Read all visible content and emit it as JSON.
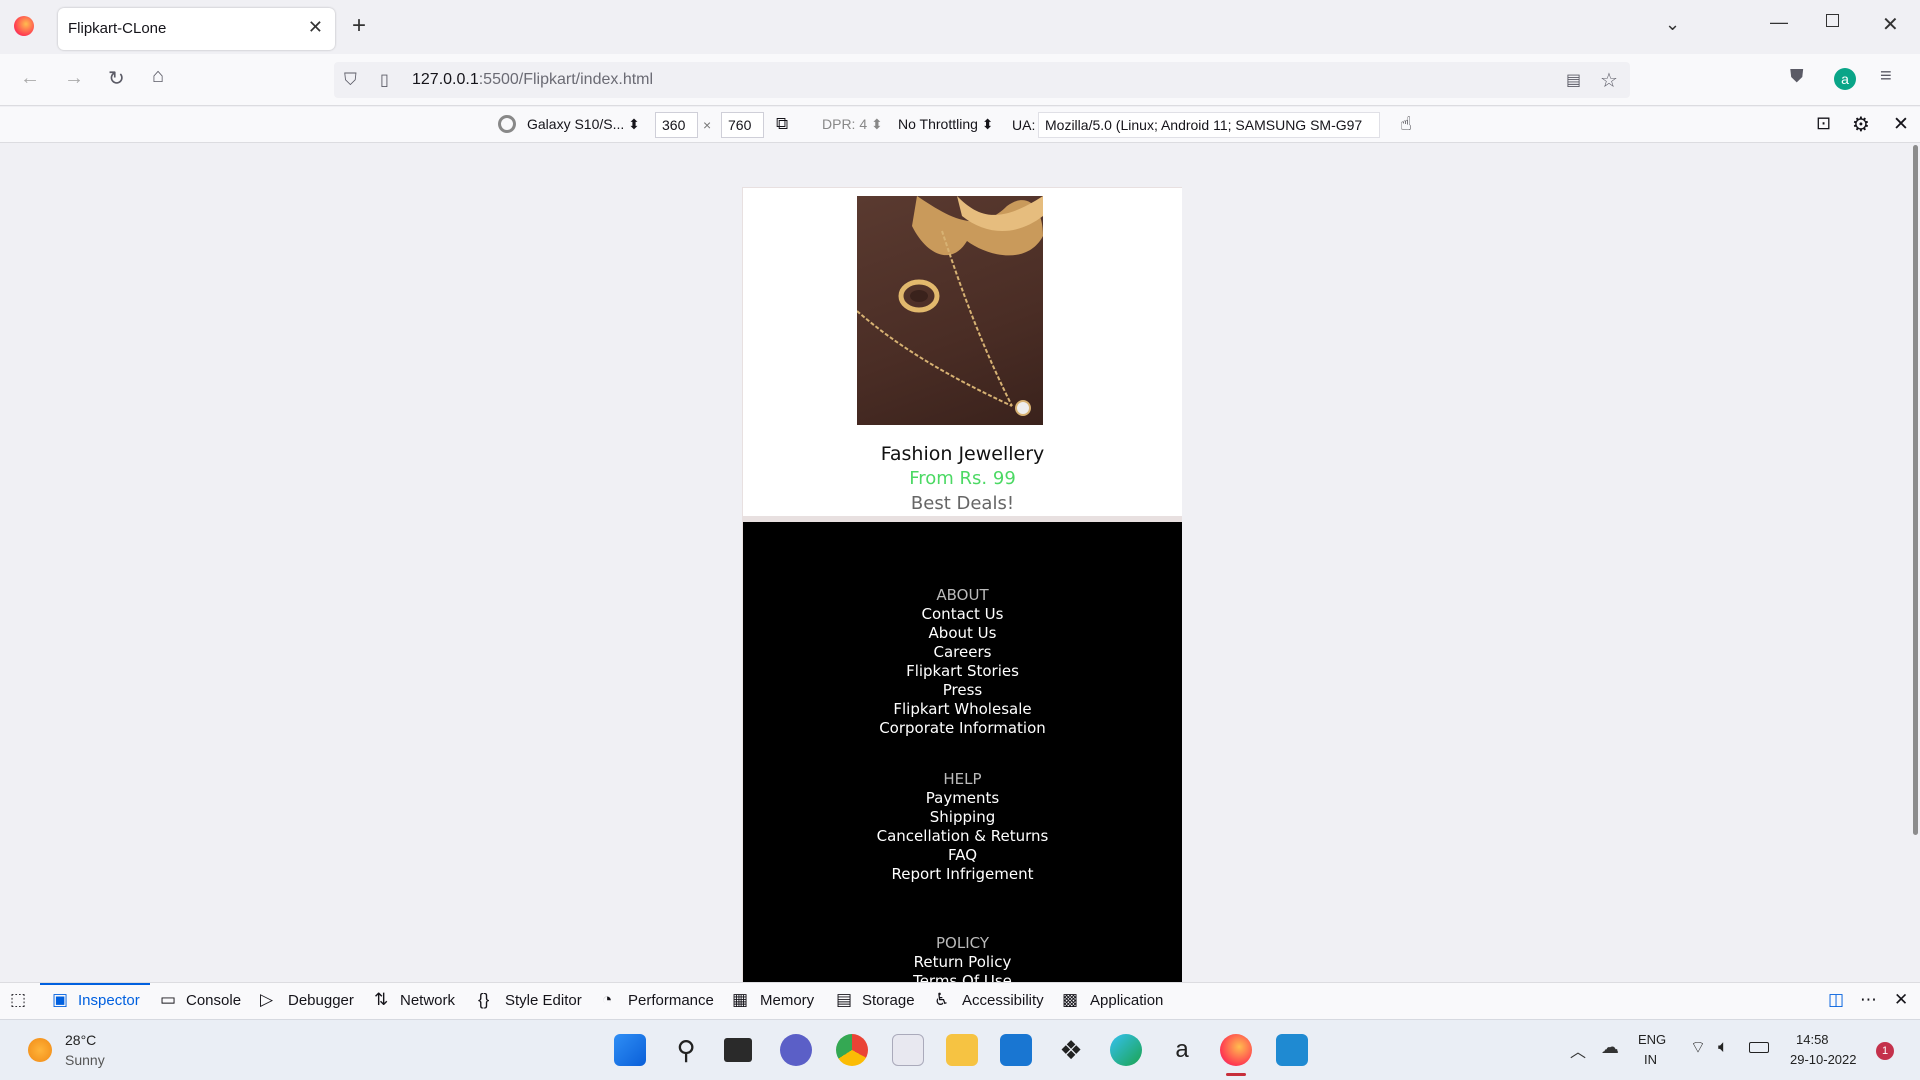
{
  "browser": {
    "tab_title": "Flipkart-CLone",
    "url_host": "127.0.0.1",
    "url_rest": ":5500/Flipkart/index.html"
  },
  "rdm": {
    "device": "Galaxy S10/S...",
    "width": "360",
    "times": "×",
    "height": "760",
    "dpr": "DPR: 4",
    "throttling": "No Throttling",
    "ua_label": "UA:",
    "ua_value": "Mozilla/5.0 (Linux; Android 11; SAMSUNG SM-G97"
  },
  "product": {
    "name": "Fashion Jewellery",
    "price": "From Rs. 99",
    "deal": "Best Deals!"
  },
  "footer": {
    "about_heading": "ABOUT",
    "about_links": [
      "Contact Us",
      "About Us",
      "Careers",
      "Flipkart Stories",
      "Press",
      "Flipkart Wholesale",
      "Corporate Information"
    ],
    "help_heading": "HELP",
    "help_links": [
      "Payments",
      "Shipping",
      "Cancellation & Returns",
      "FAQ",
      "Report Infrigement"
    ],
    "policy_heading": "POLICY",
    "policy_links": [
      "Return Policy",
      "Terms Of Use"
    ]
  },
  "devtools": {
    "tabs": [
      "Inspector",
      "Console",
      "Debugger",
      "Network",
      "Style Editor",
      "Performance",
      "Memory",
      "Storage",
      "Accessibility",
      "Application"
    ]
  },
  "taskbar": {
    "temp": "28°C",
    "weather": "Sunny",
    "lang1": "ENG",
    "lang2": "IN",
    "time": "14:58",
    "date": "29-10-2022",
    "notif": "1"
  },
  "colors": {
    "price_green": "#4cd964",
    "accent_blue": "#0060df"
  }
}
